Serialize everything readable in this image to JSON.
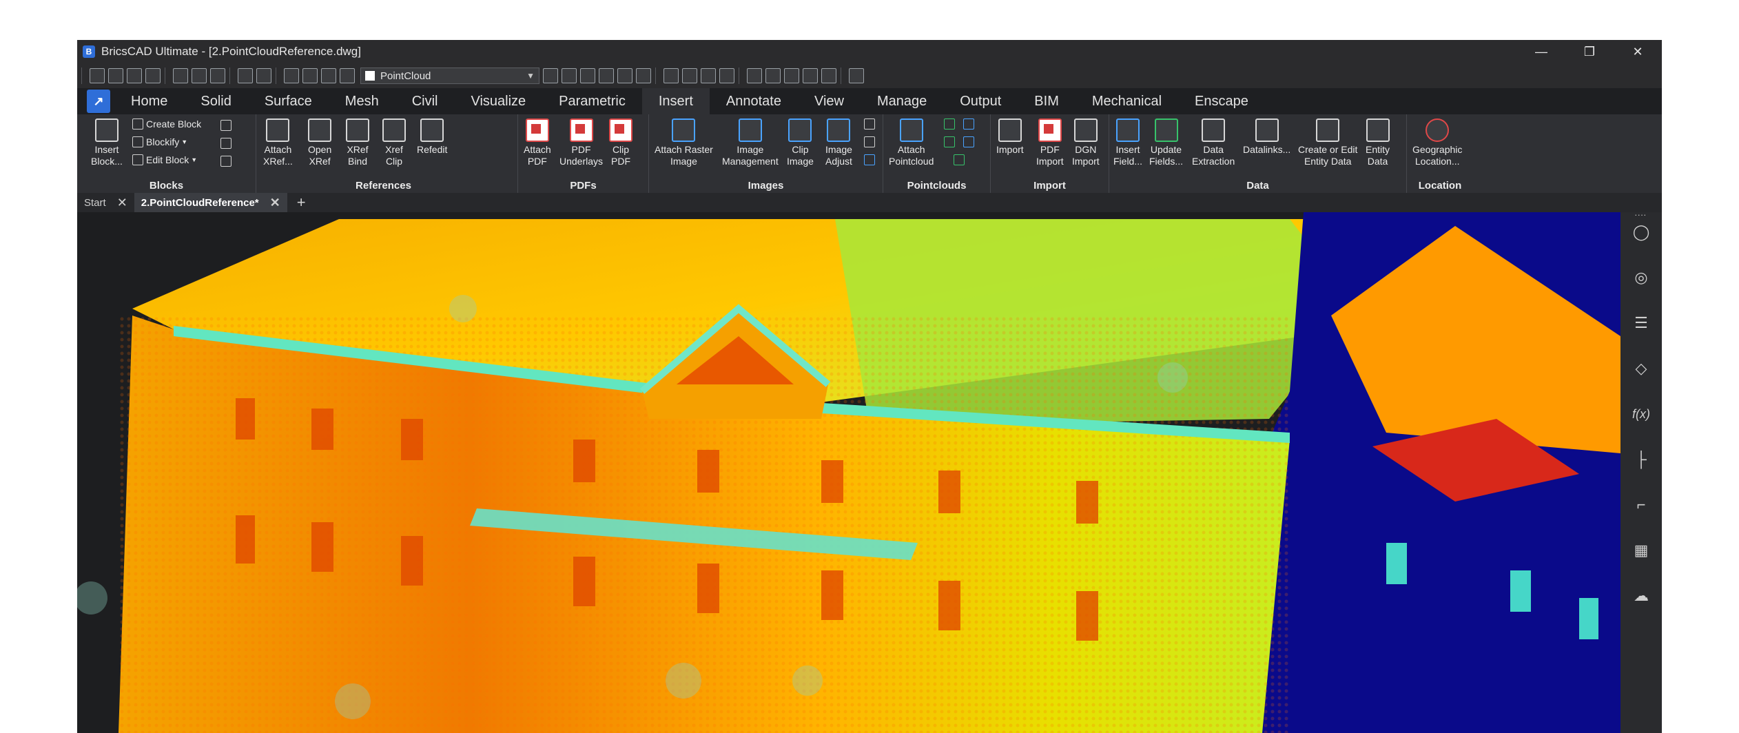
{
  "window": {
    "title": "BricsCAD Ultimate - [2.PointCloudReference.dwg]",
    "controls": [
      "minimize",
      "restore",
      "close"
    ]
  },
  "qat": {
    "layer": "PointCloud"
  },
  "ribbon_tabs": [
    "Home",
    "Solid",
    "Surface",
    "Mesh",
    "Civil",
    "Visualize",
    "Parametric",
    "Insert",
    "Annotate",
    "View",
    "Manage",
    "Output",
    "BIM",
    "Mechanical",
    "Enscape"
  ],
  "active_tab": "Insert",
  "ribbon": {
    "blocks": {
      "label": "Blocks",
      "insert_block": "Insert\nBlock...",
      "create_block": "Create Block",
      "blockify": "Blockify",
      "edit_block": "Edit Block"
    },
    "references": {
      "label": "References",
      "tools": [
        "Attach\nXRef...",
        "Open\nXRef",
        "XRef\nBind",
        "Xref\nClip",
        "Refedit"
      ]
    },
    "pdfs": {
      "label": "PDFs",
      "tools": [
        "Attach\nPDF",
        "PDF\nUnderlays",
        "Clip\nPDF"
      ]
    },
    "images": {
      "label": "Images",
      "tools": [
        "Attach Raster\nImage",
        "Image\nManagement",
        "Clip\nImage",
        "Image\nAdjust"
      ]
    },
    "pointclouds": {
      "label": "Pointclouds",
      "tools": [
        "Attach\nPointcloud"
      ]
    },
    "import": {
      "label": "Import",
      "tools": [
        "Import",
        "PDF\nImport",
        "DGN\nImport"
      ]
    },
    "data": {
      "label": "Data",
      "tools": [
        "Insert\nField...",
        "Update\nFields...",
        "Data\nExtraction",
        "Datalinks...",
        "Create or Edit\nEntity Data",
        "Entity\nData"
      ]
    },
    "location": {
      "label": "Location",
      "tools": [
        "Geographic\nLocation..."
      ]
    }
  },
  "document_tabs": [
    {
      "label": "Start",
      "active": false
    },
    {
      "label": "2.PointCloudReference*",
      "active": true
    }
  ],
  "side_panel_icons": [
    "lightbulb-icon",
    "balloon-icon",
    "sliders-icon",
    "layers-icon",
    "fx-icon",
    "tree-icon",
    "paperclip-icon",
    "hatch-icon",
    "cloud-upload-icon"
  ],
  "colors": {
    "accent": "#2f6ed8",
    "background": "#202124"
  }
}
